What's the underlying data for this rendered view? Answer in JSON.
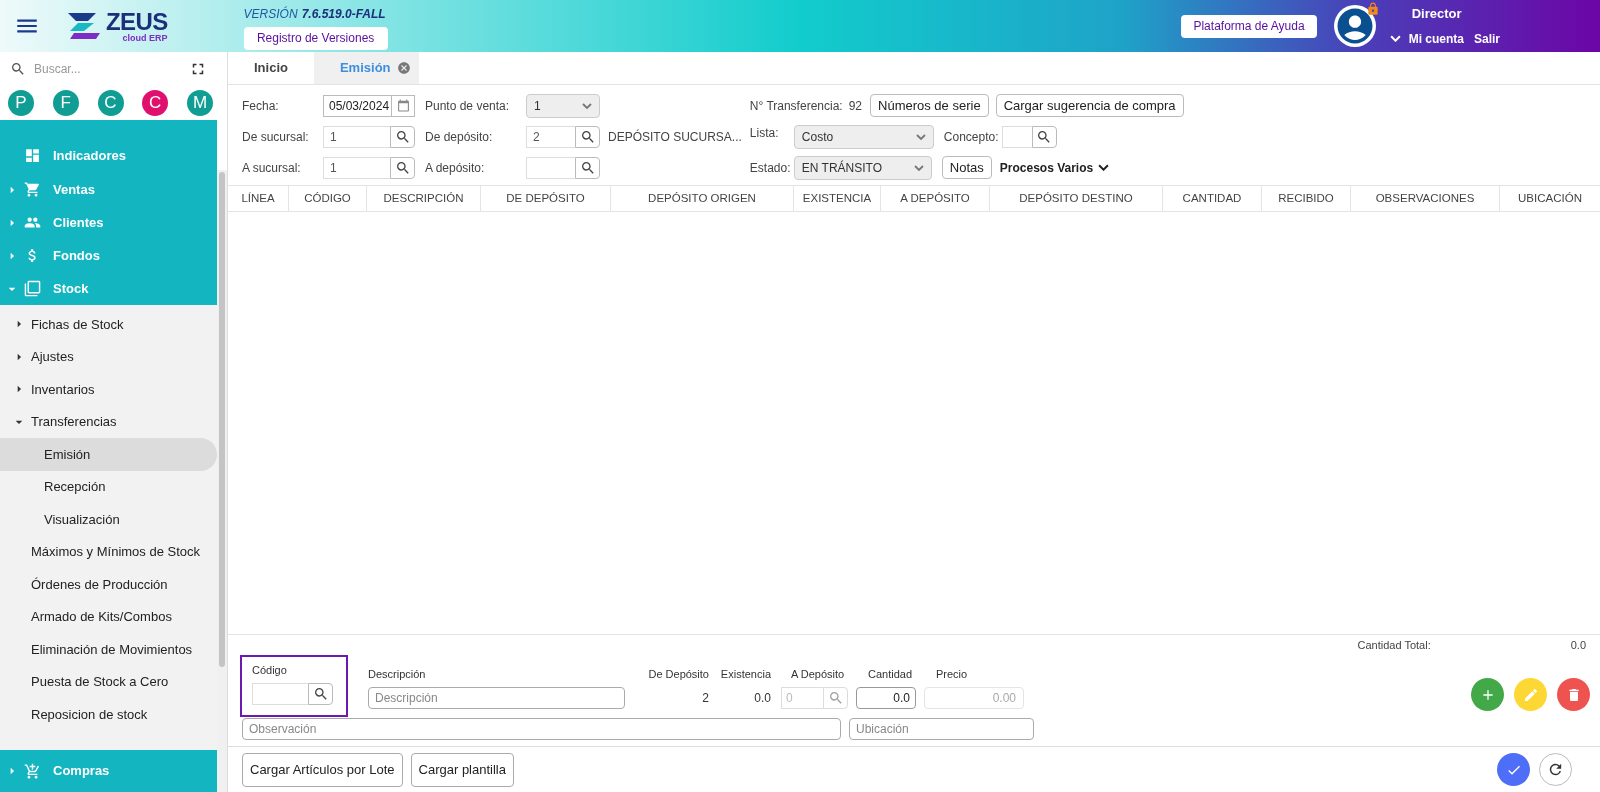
{
  "header": {
    "logo": {
      "name": "ZEUS",
      "tagline": "cloud ERP"
    },
    "version_label": "VERSIÓN",
    "version": "7.6.519.0-FALL",
    "versions_button": "Registro de Versiones",
    "help_button": "Plataforma de Ayuda",
    "user": {
      "role": "Director",
      "account_link": "Mi cuenta",
      "logout_link": "Salir",
      "locked": true
    }
  },
  "sidebar": {
    "search": {
      "placeholder": "Buscar..."
    },
    "shortcuts": [
      {
        "label": "P",
        "color": "#0f9d94"
      },
      {
        "label": "F",
        "color": "#0f9d94"
      },
      {
        "label": "C",
        "color": "#0f9d94"
      },
      {
        "label": "C",
        "color": "#e0106f"
      },
      {
        "label": "M",
        "color": "#0f9d94"
      }
    ],
    "items": [
      {
        "label": "Indicadores",
        "selected": false
      },
      {
        "label": "Ventas",
        "expanded": false,
        "selected": false
      },
      {
        "label": "Clientes",
        "expanded": false,
        "selected": false
      },
      {
        "label": "Fondos",
        "expanded": false,
        "selected": false
      },
      {
        "label": "Stock",
        "expanded": true,
        "selected": false,
        "children": [
          {
            "label": "Fichas de Stock",
            "expanded": false,
            "selected": false
          },
          {
            "label": "Ajustes",
            "expanded": false,
            "selected": false
          },
          {
            "label": "Inventarios",
            "expanded": false,
            "selected": false
          },
          {
            "label": "Transferencias",
            "expanded": true,
            "selected": false,
            "children": [
              {
                "label": "Emisión",
                "selected": true
              },
              {
                "label": "Recepción",
                "selected": false
              },
              {
                "label": "Visualización",
                "selected": false
              }
            ]
          },
          {
            "label": "Máximos y Mínimos de Stock",
            "selected": false
          },
          {
            "label": "Órdenes de Producción",
            "selected": false
          },
          {
            "label": "Armado de Kits/Combos",
            "selected": false
          },
          {
            "label": "Eliminación de Movimientos",
            "selected": false
          },
          {
            "label": "Puesta de Stock a Cero",
            "selected": false
          },
          {
            "label": "Reposicion de stock",
            "selected": false
          }
        ]
      },
      {
        "label": "Compras",
        "expanded": false,
        "selected": false
      }
    ]
  },
  "tabs": [
    {
      "label": "Inicio",
      "selected": false,
      "closable": false
    },
    {
      "label": "Emisión",
      "selected": true,
      "closable": true
    }
  ],
  "form": {
    "fecha": {
      "label": "Fecha:",
      "value": "05/03/2024"
    },
    "punto_de_venta": {
      "label": "Punto de venta:",
      "value": "1"
    },
    "de_sucursal": {
      "label": "De sucursal:",
      "value": "1"
    },
    "de_deposito": {
      "label": "De depósito:",
      "value": "2",
      "name": "DEPÓSITO SUCURSA..."
    },
    "a_sucursal": {
      "label": "A sucursal:",
      "value": "1"
    },
    "a_deposito": {
      "label": "A depósito:"
    },
    "transferencia": {
      "label": "N° Transferencia:",
      "value": "92"
    },
    "serial_button": "Números de serie",
    "suggestion_button": "Cargar sugerencia de compra",
    "lista": {
      "label": "Lista:",
      "value": "Costo"
    },
    "concepto": {
      "label": "Concepto:"
    },
    "estado": {
      "label": "Estado:",
      "value": "EN TRÁNSITO"
    },
    "notes_button": "Notas",
    "processes_menu": "Procesos Varios"
  },
  "table": {
    "columns": [
      "LÍNEA",
      "CÓDIGO",
      "DESCRIPCIÓN",
      "DE DEPÓSITO",
      "DEPÓSITO ORIGEN",
      "EXISTENCIA",
      "A DEPÓSITO",
      "DEPÓSITO DESTINO",
      "CANTIDAD",
      "RECIBIDO",
      "OBSERVACIONES",
      "UBICACIÓN"
    ]
  },
  "total": {
    "label": "Cantidad Total:",
    "value": "0.0"
  },
  "entry": {
    "codigo": {
      "label": "Código"
    },
    "descripcion": {
      "label": "Descripción",
      "placeholder": "Descripción"
    },
    "de_deposito": {
      "label": "De Depósito",
      "value": "2"
    },
    "existencia": {
      "label": "Existencia",
      "value": "0.0"
    },
    "a_deposito": {
      "label": "A Depósito",
      "value": "0",
      "disabled": true
    },
    "cantidad": {
      "label": "Cantidad",
      "value": "0.0"
    },
    "precio": {
      "label": "Precio",
      "value": "0.00",
      "disabled": true
    },
    "observacion": {
      "placeholder": "Observación"
    },
    "ubicacion": {
      "placeholder": "Ubicación"
    }
  },
  "footer": {
    "buttons": [
      "Cargar Artículos por Lote",
      "Cargar plantilla"
    ]
  }
}
